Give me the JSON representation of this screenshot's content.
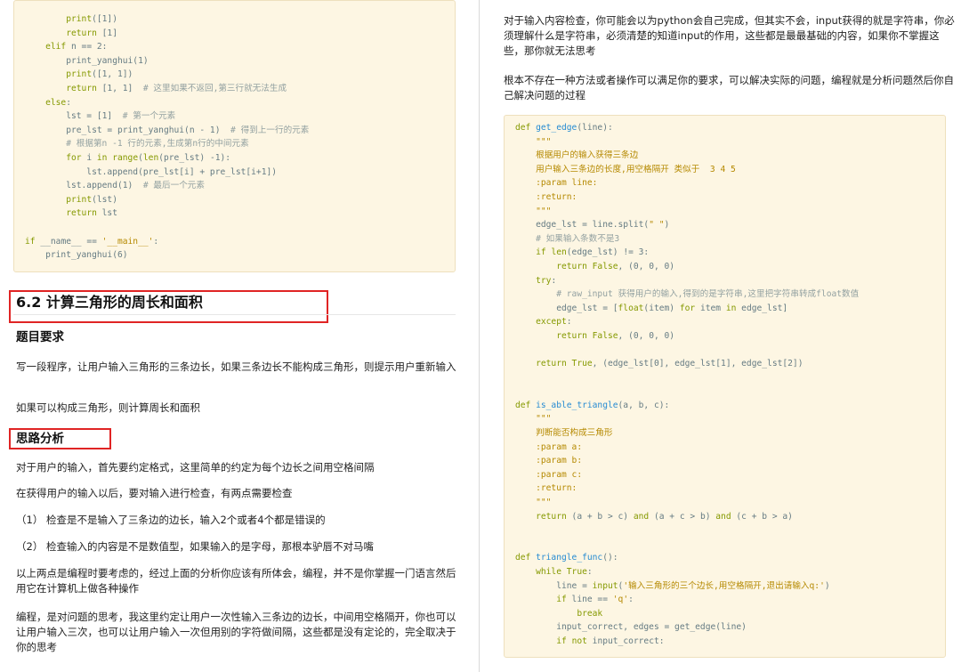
{
  "left": {
    "code_lines": [
      [
        {
          "t": "        ",
          "c": "txt"
        },
        {
          "t": "print",
          "c": "kw"
        },
        {
          "t": "([1])",
          "c": "txt"
        }
      ],
      [
        {
          "t": "        ",
          "c": "txt"
        },
        {
          "t": "return",
          "c": "kw"
        },
        {
          "t": " [1]",
          "c": "txt"
        }
      ],
      [
        {
          "t": "    ",
          "c": "txt"
        },
        {
          "t": "elif",
          "c": "kw"
        },
        {
          "t": " n == 2:",
          "c": "txt"
        }
      ],
      [
        {
          "t": "        print_yanghui(1)",
          "c": "txt"
        }
      ],
      [
        {
          "t": "        ",
          "c": "txt"
        },
        {
          "t": "print",
          "c": "kw"
        },
        {
          "t": "([1, 1])",
          "c": "txt"
        }
      ],
      [
        {
          "t": "        ",
          "c": "txt"
        },
        {
          "t": "return",
          "c": "kw"
        },
        {
          "t": " [1, 1]  ",
          "c": "txt"
        },
        {
          "t": "# 这里如果不返回,第三行就无法生成",
          "c": "cm"
        }
      ],
      [
        {
          "t": "    ",
          "c": "txt"
        },
        {
          "t": "else",
          "c": "kw"
        },
        {
          "t": ":",
          "c": "txt"
        }
      ],
      [
        {
          "t": "        lst = [1]  ",
          "c": "txt"
        },
        {
          "t": "# 第一个元素",
          "c": "cm"
        }
      ],
      [
        {
          "t": "        pre_lst = print_yanghui(n - 1)  ",
          "c": "txt"
        },
        {
          "t": "# 得到上一行的元素",
          "c": "cm"
        }
      ],
      [
        {
          "t": "        ",
          "c": "txt"
        },
        {
          "t": "# 根据第n -1 行的元素,生成第n行的中间元素",
          "c": "cm"
        }
      ],
      [
        {
          "t": "        ",
          "c": "txt"
        },
        {
          "t": "for",
          "c": "kw"
        },
        {
          "t": " i ",
          "c": "txt"
        },
        {
          "t": "in",
          "c": "kw"
        },
        {
          "t": " ",
          "c": "txt"
        },
        {
          "t": "range",
          "c": "kw"
        },
        {
          "t": "(",
          "c": "txt"
        },
        {
          "t": "len",
          "c": "kw"
        },
        {
          "t": "(pre_lst) -1):",
          "c": "txt"
        }
      ],
      [
        {
          "t": "            lst.append(pre_lst[i] + pre_lst[i+1])",
          "c": "txt"
        }
      ],
      [
        {
          "t": "        lst.append(1)  ",
          "c": "txt"
        },
        {
          "t": "# 最后一个元素",
          "c": "cm"
        }
      ],
      [
        {
          "t": "        ",
          "c": "txt"
        },
        {
          "t": "print",
          "c": "kw"
        },
        {
          "t": "(lst)",
          "c": "txt"
        }
      ],
      [
        {
          "t": "        ",
          "c": "txt"
        },
        {
          "t": "return",
          "c": "kw"
        },
        {
          "t": " lst",
          "c": "txt"
        }
      ],
      [
        {
          "t": "",
          "c": "txt"
        }
      ],
      [
        {
          "t": "if",
          "c": "kw"
        },
        {
          "t": " __name__ == ",
          "c": "txt"
        },
        {
          "t": "'__main__'",
          "c": "str"
        },
        {
          "t": ":",
          "c": "txt"
        }
      ],
      [
        {
          "t": "    print_yanghui(6)",
          "c": "txt"
        }
      ]
    ],
    "section_title": "6.2 计算三角形的周长和面积",
    "req_title": "题目要求",
    "req_p1": "写一段程序，让用户输入三角形的三条边长，如果三条边长不能构成三角形，则提示用户重新输入",
    "req_p2": "如果可以构成三角形，则计算周长和面积",
    "analysis_title": "思路分析",
    "ana_p1": "对于用户的输入，首先要约定格式，这里简单的约定为每个边长之间用空格间隔",
    "ana_p2": "在获得用户的输入以后，要对输入进行检查，有两点需要检查",
    "ana_p3": "（1） 检查是不是输入了三条边的边长，输入2个或者4个都是错误的",
    "ana_p4": "（2） 检查输入的内容是不是数值型，如果输入的是字母，那根本驴唇不对马嘴",
    "ana_p5": "以上两点是编程时要考虑的，经过上面的分析你应该有所体会，编程，并不是你掌握一门语言然后用它在计算机上做各种操作",
    "ana_p6": "编程，是对问题的思考，我这里约定让用户一次性输入三条边的边长，中间用空格隔开，你也可以让用户输入三次，也可以让用户输入一次但用别的字符做间隔，这些都是没有定论的，完全取决于你的思考"
  },
  "right": {
    "p1": "对于输入内容检查，你可能会以为python会自己完成，但其实不会，input获得的就是字符串，你必须理解什么是字符串，必须清楚的知道input的作用，这些都是最最基础的内容，如果你不掌握这些，那你就无法思考",
    "p2": "根本不存在一种方法或者操作可以满足你的要求，可以解决实际的问题，编程就是分析问题然后你自己解决问题的过程",
    "code_lines": [
      [
        {
          "t": "def",
          "c": "kw"
        },
        {
          "t": " ",
          "c": "txt"
        },
        {
          "t": "get_edge",
          "c": "fn"
        },
        {
          "t": "(line):",
          "c": "txt"
        }
      ],
      [
        {
          "t": "    ",
          "c": "txt"
        },
        {
          "t": "\"\"\"",
          "c": "str"
        }
      ],
      [
        {
          "t": "    ",
          "c": "txt"
        },
        {
          "t": "根据用户的输入获得三条边",
          "c": "str"
        }
      ],
      [
        {
          "t": "    ",
          "c": "txt"
        },
        {
          "t": "用户输入三条边的长度,用空格隔开 类似于  3 4 5",
          "c": "str"
        }
      ],
      [
        {
          "t": "    ",
          "c": "txt"
        },
        {
          "t": ":param line:",
          "c": "str"
        }
      ],
      [
        {
          "t": "    ",
          "c": "txt"
        },
        {
          "t": ":return:",
          "c": "str"
        }
      ],
      [
        {
          "t": "    ",
          "c": "txt"
        },
        {
          "t": "\"\"\"",
          "c": "str"
        }
      ],
      [
        {
          "t": "    edge_lst = line.split(",
          "c": "txt"
        },
        {
          "t": "\" \"",
          "c": "str"
        },
        {
          "t": ")",
          "c": "txt"
        }
      ],
      [
        {
          "t": "    ",
          "c": "txt"
        },
        {
          "t": "# 如果输入条数不是3",
          "c": "cm"
        }
      ],
      [
        {
          "t": "    ",
          "c": "txt"
        },
        {
          "t": "if",
          "c": "kw"
        },
        {
          "t": " ",
          "c": "txt"
        },
        {
          "t": "len",
          "c": "kw"
        },
        {
          "t": "(edge_lst) != 3:",
          "c": "txt"
        }
      ],
      [
        {
          "t": "        ",
          "c": "txt"
        },
        {
          "t": "return",
          "c": "kw"
        },
        {
          "t": " ",
          "c": "txt"
        },
        {
          "t": "False",
          "c": "kw"
        },
        {
          "t": ", (0, 0, 0)",
          "c": "txt"
        }
      ],
      [
        {
          "t": "    ",
          "c": "txt"
        },
        {
          "t": "try",
          "c": "kw"
        },
        {
          "t": ":",
          "c": "txt"
        }
      ],
      [
        {
          "t": "        ",
          "c": "txt"
        },
        {
          "t": "# raw_input 获得用户的输入,得到的是字符串,这里把字符串转成float数值",
          "c": "cm"
        }
      ],
      [
        {
          "t": "        edge_lst = [",
          "c": "txt"
        },
        {
          "t": "float",
          "c": "kw"
        },
        {
          "t": "(item) ",
          "c": "txt"
        },
        {
          "t": "for",
          "c": "kw"
        },
        {
          "t": " item ",
          "c": "txt"
        },
        {
          "t": "in",
          "c": "kw"
        },
        {
          "t": " edge_lst]",
          "c": "txt"
        }
      ],
      [
        {
          "t": "    ",
          "c": "txt"
        },
        {
          "t": "except",
          "c": "kw"
        },
        {
          "t": ":",
          "c": "txt"
        }
      ],
      [
        {
          "t": "        ",
          "c": "txt"
        },
        {
          "t": "return",
          "c": "kw"
        },
        {
          "t": " ",
          "c": "txt"
        },
        {
          "t": "False",
          "c": "kw"
        },
        {
          "t": ", (0, 0, 0)",
          "c": "txt"
        }
      ],
      [
        {
          "t": "",
          "c": "txt"
        }
      ],
      [
        {
          "t": "    ",
          "c": "txt"
        },
        {
          "t": "return",
          "c": "kw"
        },
        {
          "t": " ",
          "c": "txt"
        },
        {
          "t": "True",
          "c": "kw"
        },
        {
          "t": ", (edge_lst[0], edge_lst[1], edge_lst[2])",
          "c": "txt"
        }
      ],
      [
        {
          "t": "",
          "c": "txt"
        }
      ],
      [
        {
          "t": "",
          "c": "txt"
        }
      ],
      [
        {
          "t": "def",
          "c": "kw"
        },
        {
          "t": " ",
          "c": "txt"
        },
        {
          "t": "is_able_triangle",
          "c": "fn"
        },
        {
          "t": "(a, b, c):",
          "c": "txt"
        }
      ],
      [
        {
          "t": "    ",
          "c": "txt"
        },
        {
          "t": "\"\"\"",
          "c": "str"
        }
      ],
      [
        {
          "t": "    ",
          "c": "txt"
        },
        {
          "t": "判断能否构成三角形",
          "c": "str"
        }
      ],
      [
        {
          "t": "    ",
          "c": "txt"
        },
        {
          "t": ":param a:",
          "c": "str"
        }
      ],
      [
        {
          "t": "    ",
          "c": "txt"
        },
        {
          "t": ":param b:",
          "c": "str"
        }
      ],
      [
        {
          "t": "    ",
          "c": "txt"
        },
        {
          "t": ":param c:",
          "c": "str"
        }
      ],
      [
        {
          "t": "    ",
          "c": "txt"
        },
        {
          "t": ":return:",
          "c": "str"
        }
      ],
      [
        {
          "t": "    ",
          "c": "txt"
        },
        {
          "t": "\"\"\"",
          "c": "str"
        }
      ],
      [
        {
          "t": "    ",
          "c": "txt"
        },
        {
          "t": "return",
          "c": "kw"
        },
        {
          "t": " (a + b > c) ",
          "c": "txt"
        },
        {
          "t": "and",
          "c": "kw"
        },
        {
          "t": " (a + c > b) ",
          "c": "txt"
        },
        {
          "t": "and",
          "c": "kw"
        },
        {
          "t": " (c + b > a)",
          "c": "txt"
        }
      ],
      [
        {
          "t": "",
          "c": "txt"
        }
      ],
      [
        {
          "t": "",
          "c": "txt"
        }
      ],
      [
        {
          "t": "def",
          "c": "kw"
        },
        {
          "t": " ",
          "c": "txt"
        },
        {
          "t": "triangle_func",
          "c": "fn"
        },
        {
          "t": "():",
          "c": "txt"
        }
      ],
      [
        {
          "t": "    ",
          "c": "txt"
        },
        {
          "t": "while",
          "c": "kw"
        },
        {
          "t": " ",
          "c": "txt"
        },
        {
          "t": "True",
          "c": "kw"
        },
        {
          "t": ":",
          "c": "txt"
        }
      ],
      [
        {
          "t": "        line = ",
          "c": "txt"
        },
        {
          "t": "input",
          "c": "kw"
        },
        {
          "t": "(",
          "c": "txt"
        },
        {
          "t": "'输入三角形的三个边长,用空格隔开,退出请输入q:'",
          "c": "str"
        },
        {
          "t": ")",
          "c": "txt"
        }
      ],
      [
        {
          "t": "        ",
          "c": "txt"
        },
        {
          "t": "if",
          "c": "kw"
        },
        {
          "t": " line == ",
          "c": "txt"
        },
        {
          "t": "'q'",
          "c": "str"
        },
        {
          "t": ":",
          "c": "txt"
        }
      ],
      [
        {
          "t": "            ",
          "c": "txt"
        },
        {
          "t": "break",
          "c": "kw"
        }
      ],
      [
        {
          "t": "        input_correct, edges = get_edge(line)",
          "c": "txt"
        }
      ],
      [
        {
          "t": "        ",
          "c": "txt"
        },
        {
          "t": "if",
          "c": "kw"
        },
        {
          "t": " ",
          "c": "txt"
        },
        {
          "t": "not",
          "c": "kw"
        },
        {
          "t": " input_correct:",
          "c": "txt"
        }
      ]
    ]
  },
  "colors": {
    "code_bg": "#fdf6e3",
    "keyword": "#859900",
    "string": "#b58900",
    "comment": "#93a1a1",
    "highlight_box": "#e02424"
  }
}
